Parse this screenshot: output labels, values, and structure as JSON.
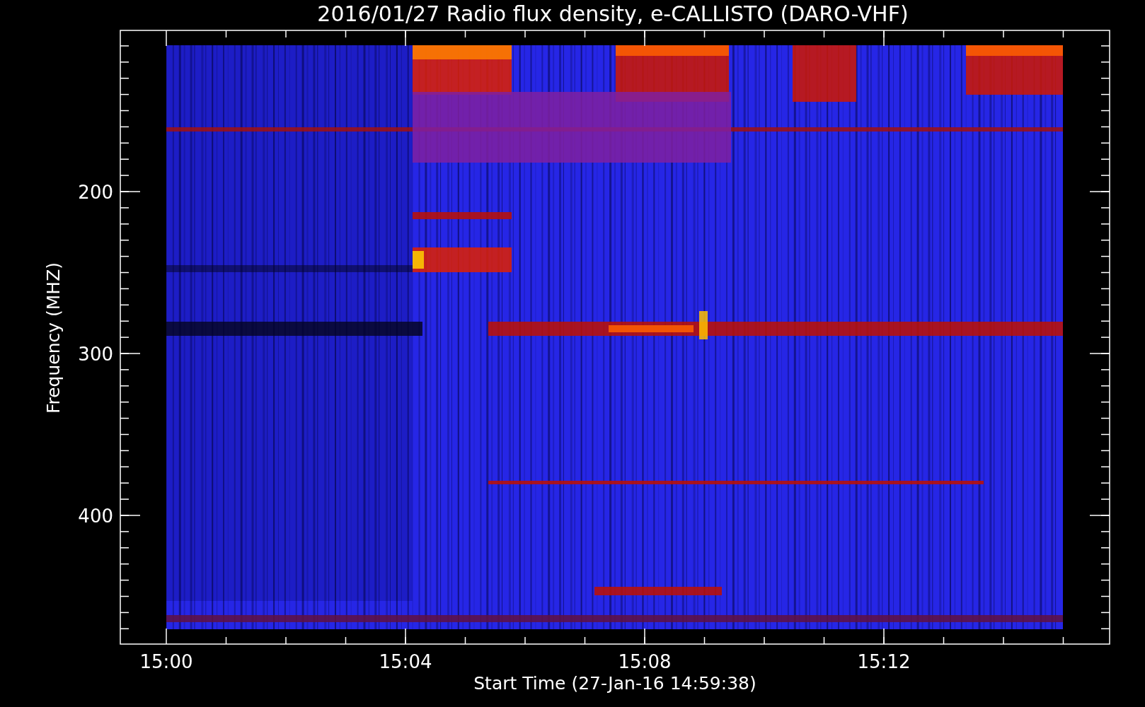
{
  "title": "2016/01/27  Radio flux density, e-CALLISTO (DARO-VHF)",
  "y_axis": {
    "label": "Frequency (MHZ)",
    "tick_labels": [
      "200",
      "300",
      "400"
    ]
  },
  "x_axis": {
    "label": "Start Time (27-Jan-16 14:59:38)",
    "tick_labels": [
      "15:00",
      "15:04",
      "15:08",
      "15:12"
    ]
  }
}
